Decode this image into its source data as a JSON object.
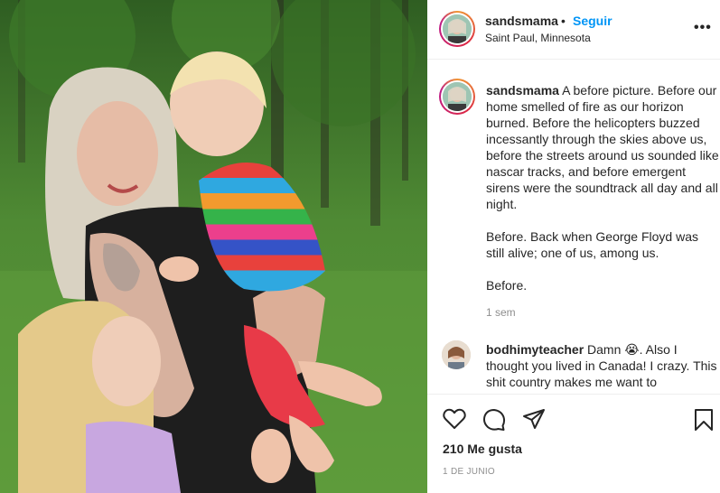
{
  "post": {
    "username": "sandsmama",
    "separator": "•",
    "follow_label": "Seguir",
    "location": "Saint Paul, Minnesota",
    "more_icon": "more-horizontal-icon",
    "more_label": "•••"
  },
  "caption": {
    "username": "sandsmama",
    "paragraph1": "A before picture. Before our home smelled of fire as our horizon burned. Before the helicopters buzzed incessantly through the skies above us, before the streets around us sounded like nascar tracks, and before emergent sirens were the soundtrack all day and all night.",
    "paragraph2": "Before. Back when George Floyd was still alive; one of us, among us.",
    "paragraph3": "Before.",
    "time_ago": "1 sem"
  },
  "comments": [
    {
      "username": "bodhimyteacher",
      "text": "Damn 😭. Also I thought you lived in Canada! I crazy. This shit country makes me want to"
    }
  ],
  "actions": {
    "like_icon": "heart-icon",
    "comment_icon": "comment-icon",
    "share_icon": "share-icon",
    "save_icon": "bookmark-icon",
    "likes_text": "210 Me gusta",
    "date_text": "1 DE JUNIO"
  },
  "colors": {
    "follow_blue": "#0095f6",
    "muted_gray": "#8e8e8e",
    "text_dark": "#262626"
  }
}
